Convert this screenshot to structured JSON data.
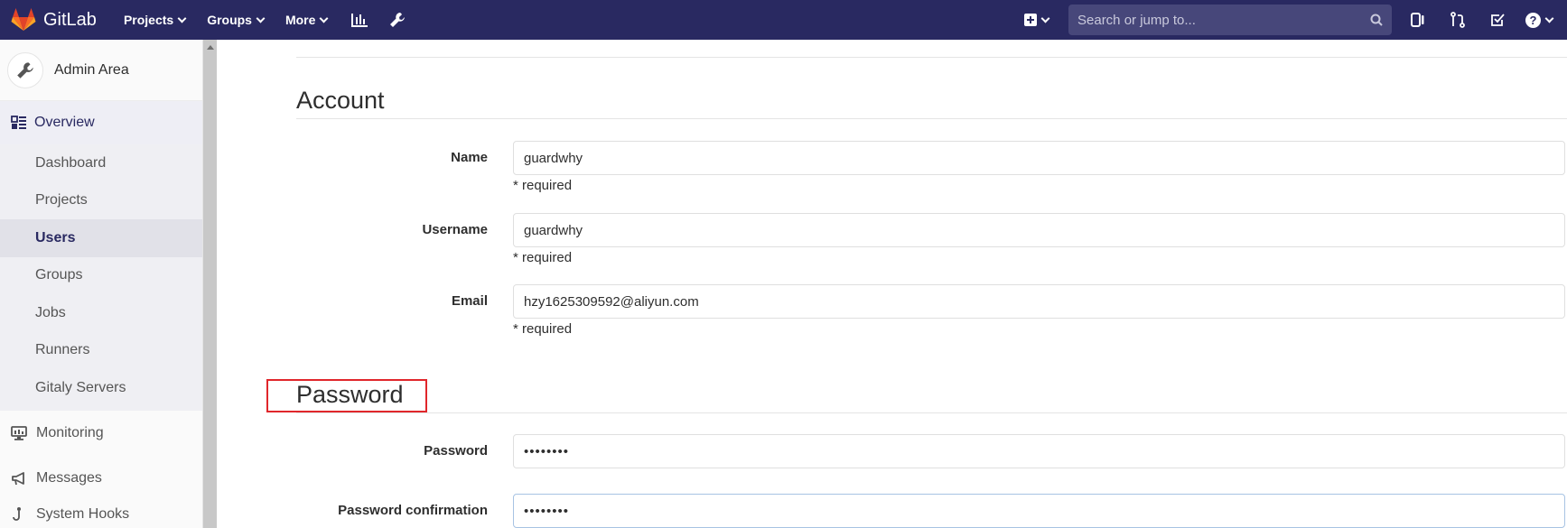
{
  "navbar": {
    "logo_text": "GitLab",
    "menu": [
      {
        "label": "Projects"
      },
      {
        "label": "Groups"
      },
      {
        "label": "More"
      }
    ],
    "search_placeholder": "Search or jump to...",
    "icons": [
      "activity-chart-icon",
      "wrench-icon",
      "plus-square-icon",
      "issues-icon",
      "merge-request-icon",
      "todo-check-icon",
      "help-icon"
    ]
  },
  "sidebar": {
    "title": "Admin Area",
    "overview_label": "Overview",
    "sub_items": [
      {
        "label": "Dashboard",
        "active": false
      },
      {
        "label": "Projects",
        "active": false
      },
      {
        "label": "Users",
        "active": true
      },
      {
        "label": "Groups",
        "active": false
      },
      {
        "label": "Jobs",
        "active": false
      },
      {
        "label": "Runners",
        "active": false
      },
      {
        "label": "Gitaly Servers",
        "active": false
      }
    ],
    "main_items": [
      {
        "label": "Monitoring",
        "icon": "monitor-icon"
      },
      {
        "label": "Messages",
        "icon": "megaphone-icon"
      },
      {
        "label": "System Hooks",
        "icon": "hook-icon"
      }
    ]
  },
  "form": {
    "account_title": "Account",
    "password_title": "Password",
    "fields": {
      "name": {
        "label": "Name",
        "value": "guardwhy",
        "help": "* required"
      },
      "username": {
        "label": "Username",
        "value": "guardwhy",
        "help": "* required"
      },
      "email": {
        "label": "Email",
        "value": "hzy1625309592@aliyun.com",
        "help": "* required"
      },
      "password": {
        "label": "Password",
        "value": "••••••••"
      },
      "password_confirmation": {
        "label": "Password confirmation",
        "value": "••••••••"
      }
    }
  },
  "colors": {
    "navbar_bg": "#292961",
    "search_bg": "#47477a",
    "highlight_border": "#e0262b",
    "sidebar_active": "#292961"
  }
}
